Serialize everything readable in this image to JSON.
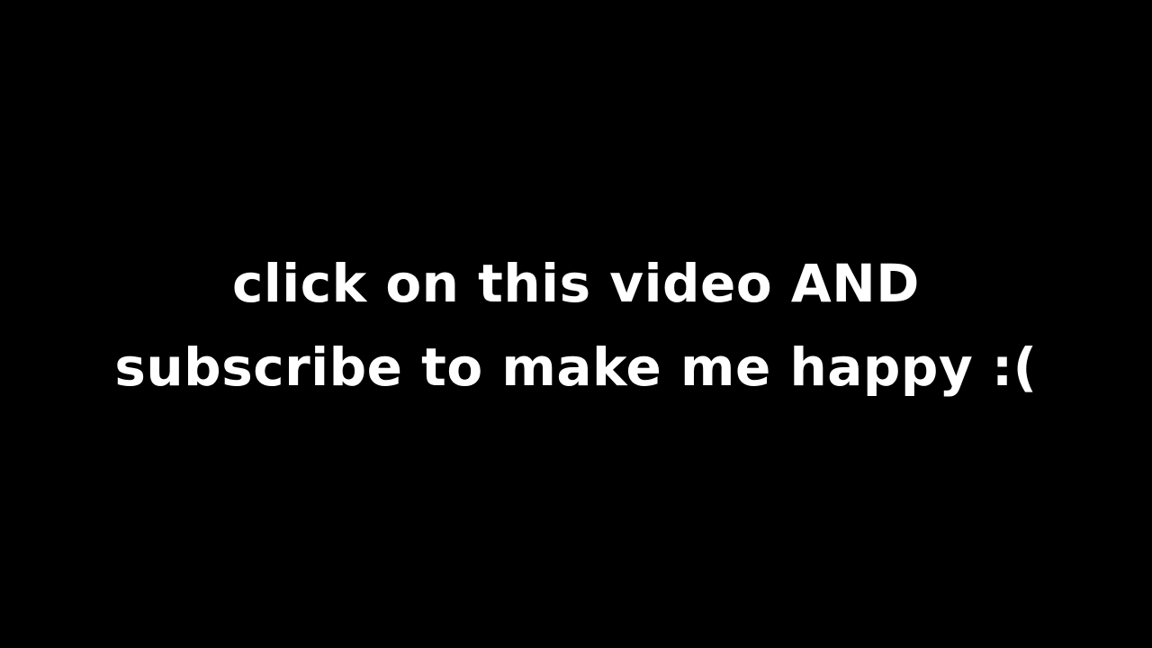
{
  "screen": {
    "background_color": "#000000",
    "text_color": "#ffffff"
  },
  "caption": {
    "line1": "click on this video AND",
    "line2": "subscribe to make me happy :("
  }
}
